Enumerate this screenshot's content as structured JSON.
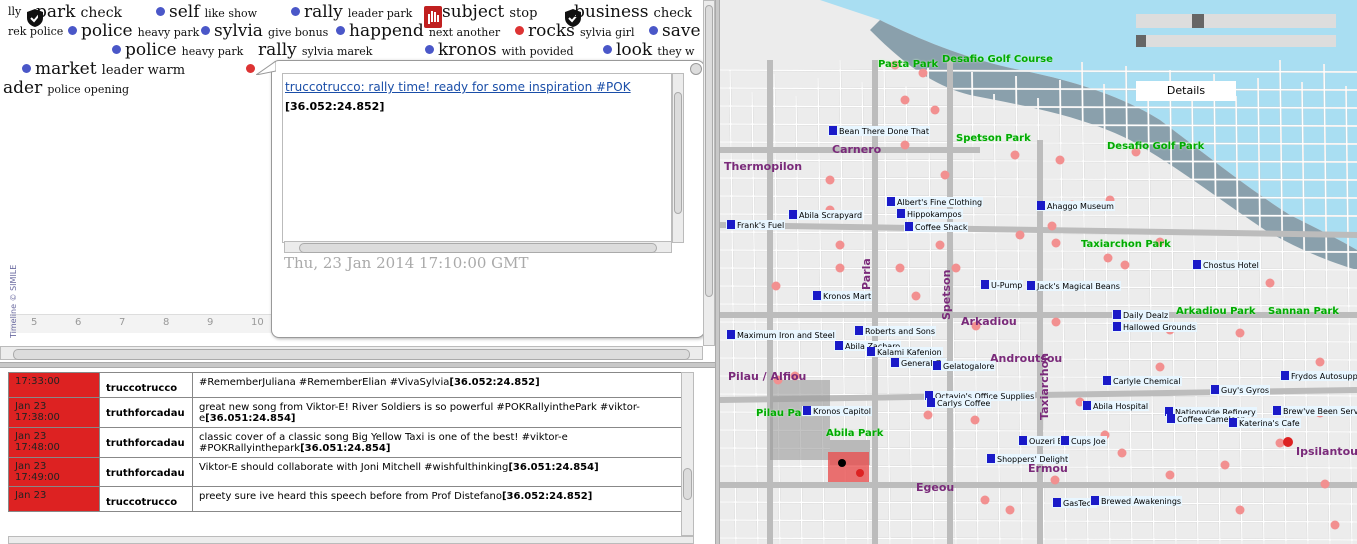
{
  "timeline": {
    "words": [
      {
        "label": "park",
        "extra": "check",
        "dot": "none"
      },
      {
        "label": "self",
        "extra": "like show",
        "dot": "blue"
      },
      {
        "label": "rally",
        "extra": "leader park",
        "dot": "blue"
      },
      {
        "label": "subject",
        "extra": "stop",
        "dot": "none"
      },
      {
        "label": "business",
        "extra": "check",
        "dot": "none"
      },
      {
        "label": "police",
        "extra": "heavy park",
        "dot": "blue"
      },
      {
        "label": "sylvia",
        "extra": "give bonus",
        "dot": "blue"
      },
      {
        "label": "happend",
        "extra": "next another",
        "dot": "blue"
      },
      {
        "label": "rocks",
        "extra": "sylvia girl",
        "dot": "red"
      },
      {
        "label": "save",
        "extra": "",
        "dot": "blue"
      },
      {
        "label": "police",
        "extra": "heavy park",
        "dot": "blue"
      },
      {
        "label": "rally",
        "extra": "sylvia marek",
        "dot": "none"
      },
      {
        "label": "kronos",
        "extra": "with povided",
        "dot": "blue"
      },
      {
        "label": "look",
        "extra": "they w",
        "dot": "blue"
      },
      {
        "label": "market",
        "extra": "leader warm",
        "dot": "blue"
      },
      {
        "label": "ader",
        "extra": "police opening",
        "dot": "none"
      }
    ],
    "fragments": {
      "lly": "lly",
      "rek_police": "rek police"
    },
    "ticks": [
      "5",
      "6",
      "7",
      "8",
      "9",
      "10"
    ],
    "credit": "Timeline © SIMILE",
    "popup": {
      "link": "truccotrucco: rally time! ready for some inspiration #POK",
      "coords": "[36.052:24.852]",
      "date": "Thu, 23 Jan 2014 17:10:00 GMT"
    }
  },
  "tweets": [
    {
      "date": "",
      "time": "17:33:00",
      "user": "truccotrucco",
      "text": "#RememberJuliana #RememberElian #VivaSylvia",
      "coords": "[36.052:24.852]"
    },
    {
      "date": "Jan 23",
      "time": "17:38:00",
      "user": "truthforcadau",
      "text": "great new song from Viktor-E! River Soldiers is so powerful #POKRallyinthePark #viktor-e",
      "coords": "[36.051:24.854]"
    },
    {
      "date": "Jan 23",
      "time": "17:48:00",
      "user": "truthforcadau",
      "text": "classic cover of a classic song Big Yellow Taxi is one of the best! #viktor-e #POKRallyinthepark",
      "coords": "[36.051:24.854]"
    },
    {
      "date": "Jan 23",
      "time": "17:49:00",
      "user": "truthforcadau",
      "text": "Viktor-E should collaborate with Joni Mitchell #wishfulthinking",
      "coords": "[36.051:24.854]"
    },
    {
      "date": "Jan 23",
      "time": "",
      "user": "truccotrucco",
      "text": "preety sure ive heard this speech before from Prof Distefano",
      "coords": "[36.052:24.852]"
    }
  ],
  "map": {
    "details_label": "Details",
    "parks": [
      "Desafio Golf Course",
      "Spetson Park",
      "Desafio Golf Park",
      "Taxiarchon Park",
      "Arkadiou Park",
      "Sannan Park",
      "Pilau Park",
      "Abila Park",
      "Pasta Park"
    ],
    "places": [
      "Bean There Done That",
      "Abila Scrapyard",
      "Albert's Fine Clothing",
      "Hippokampos",
      "Coffee Shack",
      "Frank's Fuel",
      "Kronos Mart",
      "U-Pump",
      "Jack's Magical Beans",
      "Ahaggo Museum",
      "Chostus Hotel",
      "Daily Dealz",
      "Hallowed Grounds",
      "Maximum Iron and Steel",
      "Roberts and Sons",
      "Abila Zacharo",
      "Kalami Kafenion",
      "General Gr",
      "Gelatogalore",
      "Octavio's Office Supplies",
      "Carlys Coffee",
      "Carlyle Chemical",
      "Guy's Gyros",
      "Frydos Autosupply",
      "Abila Hospital",
      "Nationwide Refinery",
      "Coffee Cameleon",
      "Brew've Been Served",
      "Katerina's Cafe",
      "Kronos Capitol",
      "Ouzeri Elian",
      "Cups Joe",
      "Shoppers' Delight",
      "GasTech",
      "Brewed Awakenings"
    ],
    "streets": [
      "Carnero",
      "Thermopilon",
      "Arkadiou",
      "Androutsou",
      "Ermou",
      "Egeou",
      "Ipsilantou",
      "Taxiarchon",
      "Parla",
      "Spetson",
      "Pilau / Alfiou"
    ],
    "accent_pin": "#dd2222",
    "park_color": "#00a000",
    "street_color": "#7a2a7a"
  }
}
